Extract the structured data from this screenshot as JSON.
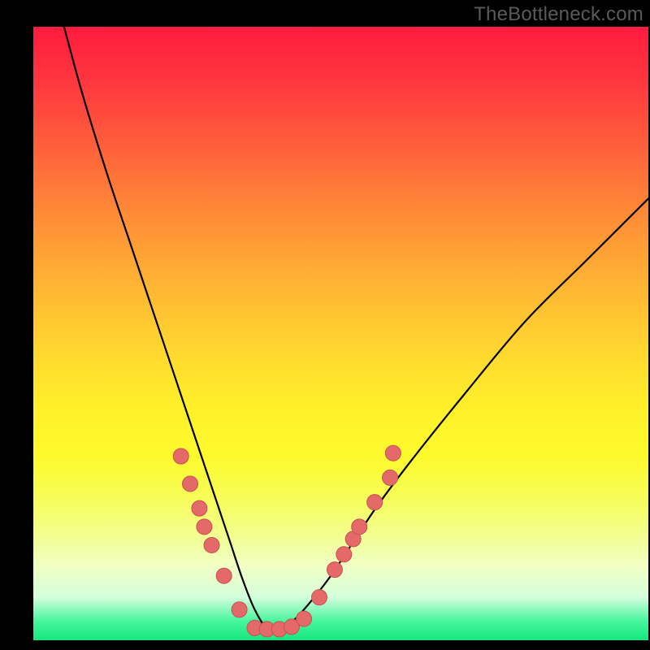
{
  "watermark": "TheBottleneck.com",
  "colors": {
    "background": "#000000",
    "curve": "#000000",
    "dot_fill": "#e46a6a",
    "dot_stroke": "#c85050",
    "gradient_top": "#ff1b3e",
    "gradient_bottom": "#17e67f"
  },
  "chart_data": {
    "type": "line",
    "title": "",
    "xlabel": "",
    "ylabel": "",
    "xlim": [
      0,
      100
    ],
    "ylim": [
      0,
      100
    ],
    "grid": false,
    "legend": false,
    "note": "Axes omitted in image; x/y are normalized 0–100 against the plot area (origin bottom-left). Curve is a V-shaped bottleneck profile with minimum near x≈38.",
    "series": [
      {
        "name": "bottleneck-curve",
        "x": [
          5,
          8,
          12,
          16,
          20,
          24,
          28,
          30,
          32,
          34,
          36,
          38,
          40,
          42,
          44,
          48,
          52,
          56,
          62,
          70,
          80,
          90,
          100
        ],
        "y": [
          100,
          89,
          76,
          64,
          52,
          40,
          28,
          22,
          16,
          10,
          5,
          2,
          2,
          3,
          5,
          10,
          16,
          22,
          30,
          40,
          52,
          62,
          72
        ]
      }
    ],
    "markers": {
      "name": "highlight-dots",
      "note": "Salmon circular markers along lower portion of curve.",
      "points": [
        {
          "x": 24.0,
          "y": 30.0
        },
        {
          "x": 25.5,
          "y": 25.5
        },
        {
          "x": 27.0,
          "y": 21.5
        },
        {
          "x": 27.8,
          "y": 18.5
        },
        {
          "x": 29.0,
          "y": 15.5
        },
        {
          "x": 31.0,
          "y": 10.5
        },
        {
          "x": 33.5,
          "y": 5.0
        },
        {
          "x": 36.0,
          "y": 2.0
        },
        {
          "x": 38.0,
          "y": 1.8
        },
        {
          "x": 40.0,
          "y": 1.8
        },
        {
          "x": 42.0,
          "y": 2.2
        },
        {
          "x": 44.0,
          "y": 3.5
        },
        {
          "x": 46.5,
          "y": 7.0
        },
        {
          "x": 49.0,
          "y": 11.5
        },
        {
          "x": 50.5,
          "y": 14.0
        },
        {
          "x": 52.0,
          "y": 16.5
        },
        {
          "x": 53.0,
          "y": 18.5
        },
        {
          "x": 55.5,
          "y": 22.5
        },
        {
          "x": 58.0,
          "y": 26.5
        },
        {
          "x": 58.5,
          "y": 30.5
        }
      ]
    }
  }
}
